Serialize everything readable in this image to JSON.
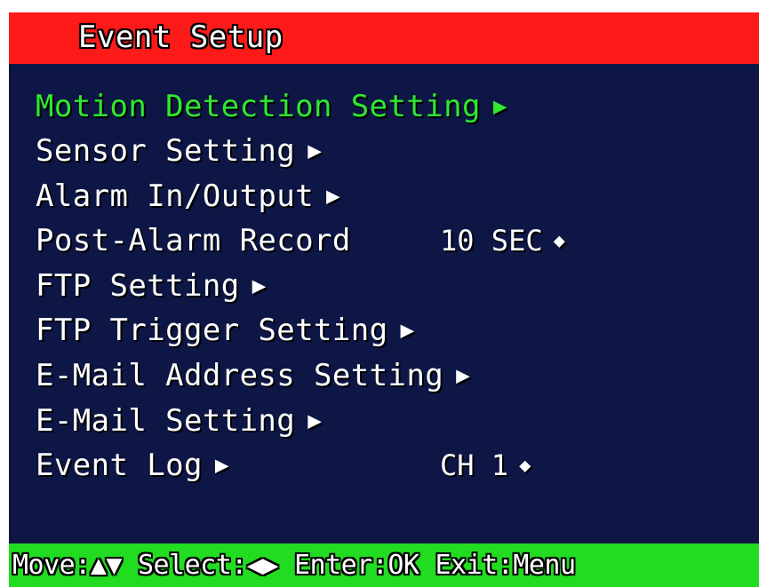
{
  "title": "Event Setup",
  "colors": {
    "title_bar": "#ff1a1a",
    "panel": "#0d1645",
    "help_bar": "#22dc22",
    "selected_text": "#2fe82f",
    "text": "#ffffff"
  },
  "menu": {
    "items": [
      {
        "label": "Motion Detection Setting",
        "icon": "right-arrow-icon",
        "arrow": "▶"
      },
      {
        "label": "Sensor Setting",
        "icon": "right-arrow-icon",
        "arrow": "▶"
      },
      {
        "label": "Alarm In/Output",
        "icon": "right-arrow-icon",
        "arrow": "▶"
      },
      {
        "label": "Post-Alarm Record",
        "value": "10 SEC",
        "value_icon": "up-down-icon",
        "updown": "◆"
      },
      {
        "label": "FTP Setting",
        "icon": "right-arrow-icon",
        "arrow": "▶"
      },
      {
        "label": "FTP Trigger Setting",
        "icon": "right-arrow-icon",
        "arrow": "▶"
      },
      {
        "label": "E-Mail Address Setting",
        "icon": "right-arrow-icon",
        "arrow": "▶"
      },
      {
        "label": "E-Mail Setting",
        "icon": "right-arrow-icon",
        "arrow": "▶"
      },
      {
        "label": "Event Log",
        "icon": "right-arrow-icon",
        "arrow": "▶",
        "value": "CH 1",
        "value_icon": "up-down-icon",
        "updown": "◆"
      }
    ],
    "selected_index": 0
  },
  "help": {
    "move_label": "Move:",
    "move_keys": "▲▼",
    "select_label": "Select:",
    "select_keys": "◀▶",
    "enter": "Enter:OK",
    "exit": "Exit:Menu"
  }
}
